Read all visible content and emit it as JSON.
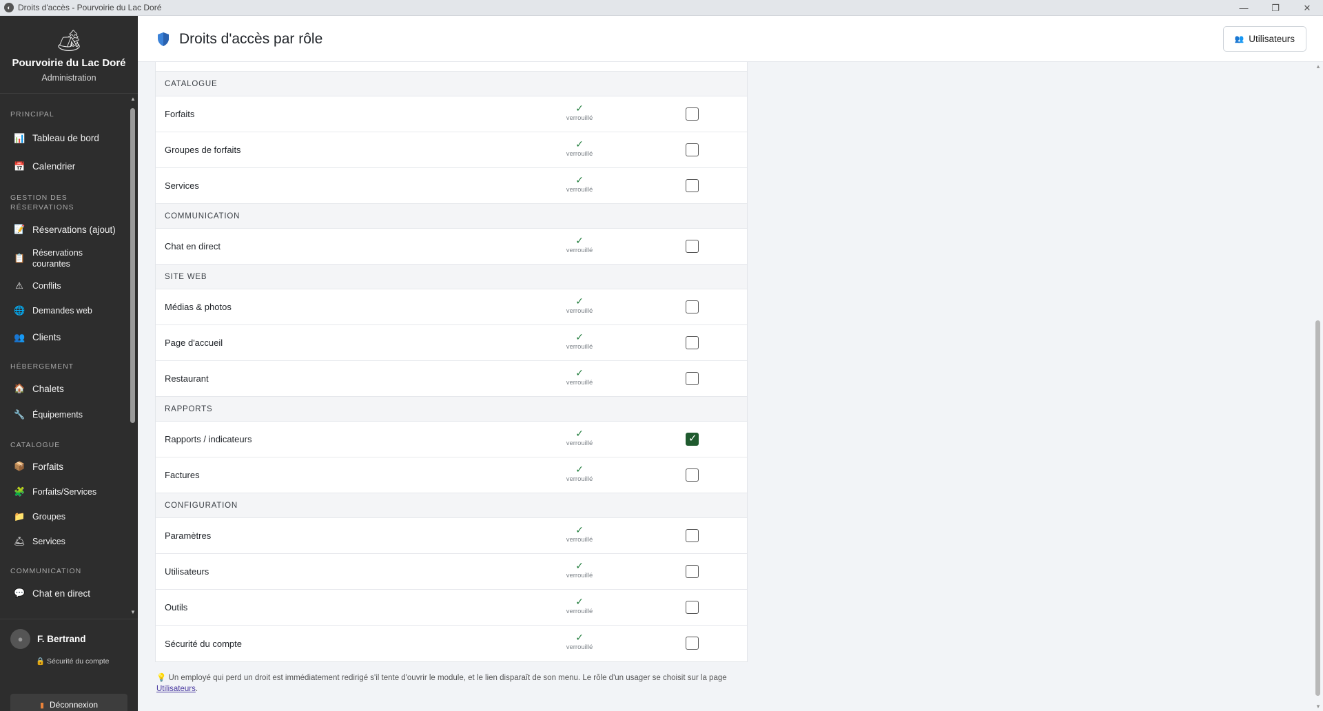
{
  "window": {
    "title": "Droits d'accès - Pourvoirie du Lac Doré",
    "minimize": "—",
    "maximize": "❐",
    "close": "✕"
  },
  "sidebar": {
    "brand_name": "Pourvoirie du Lac Doré",
    "brand_sub": "Administration",
    "sections": [
      {
        "label": "PRINCIPAL",
        "items": [
          {
            "label": "Tableau de bord",
            "icon": "chart-icon"
          },
          {
            "label": "Calendrier",
            "icon": "calendar-icon"
          }
        ]
      },
      {
        "label": "GESTION DES RÉSERVATIONS",
        "items": [
          {
            "label": "Réservations (ajout)",
            "icon": "memo-icon"
          },
          {
            "label": "Réservations courantes",
            "icon": "clipboard-icon"
          },
          {
            "label": "Conflits",
            "icon": "warning-icon"
          },
          {
            "label": "Demandes web",
            "icon": "globe-icon"
          },
          {
            "label": "Clients",
            "icon": "people-icon"
          }
        ]
      },
      {
        "label": "HÉBERGEMENT",
        "items": [
          {
            "label": "Chalets",
            "icon": "cabin-icon"
          },
          {
            "label": "Équipements",
            "icon": "wrench-icon"
          }
        ]
      },
      {
        "label": "CATALOGUE",
        "items": [
          {
            "label": "Forfaits",
            "icon": "package-icon"
          },
          {
            "label": "Forfaits/Services",
            "icon": "puzzle-icon"
          },
          {
            "label": "Groupes",
            "icon": "folder-icon"
          },
          {
            "label": "Services",
            "icon": "bell-icon"
          }
        ]
      },
      {
        "label": "COMMUNICATION",
        "items": [
          {
            "label": "Chat en direct",
            "icon": "chat-icon"
          }
        ]
      }
    ],
    "user_name": "F. Bertrand",
    "security_link": "Sécurité du compte",
    "logout": "Déconnexion"
  },
  "header": {
    "title": "Droits d'accès par rôle",
    "users_button": "Utilisateurs"
  },
  "permissions": {
    "locked_label": "verrouillé",
    "check_glyph": "✓",
    "groups": [
      {
        "label": "CATALOGUE",
        "rows": [
          {
            "name": "Forfaits",
            "checked": false
          },
          {
            "name": "Groupes de forfaits",
            "checked": false
          },
          {
            "name": "Services",
            "checked": false
          }
        ]
      },
      {
        "label": "COMMUNICATION",
        "rows": [
          {
            "name": "Chat en direct",
            "checked": false
          }
        ]
      },
      {
        "label": "SITE WEB",
        "rows": [
          {
            "name": "Médias & photos",
            "checked": false
          },
          {
            "name": "Page d'accueil",
            "checked": false
          },
          {
            "name": "Restaurant",
            "checked": false
          }
        ]
      },
      {
        "label": "RAPPORTS",
        "rows": [
          {
            "name": "Rapports / indicateurs",
            "checked": true
          },
          {
            "name": "Factures",
            "checked": false
          }
        ]
      },
      {
        "label": "CONFIGURATION",
        "rows": [
          {
            "name": "Paramètres",
            "checked": false
          },
          {
            "name": "Utilisateurs",
            "checked": false
          },
          {
            "name": "Outils",
            "checked": false
          },
          {
            "name": "Sécurité du compte",
            "checked": false
          }
        ]
      }
    ]
  },
  "note": {
    "text": "Un employé qui perd un droit est immédiatement redirigé s'il tente d'ouvrir le module, et le lien disparaît de son menu. Le rôle d'un usager se choisit sur la page ",
    "link": "Utilisateurs",
    "end": "."
  }
}
